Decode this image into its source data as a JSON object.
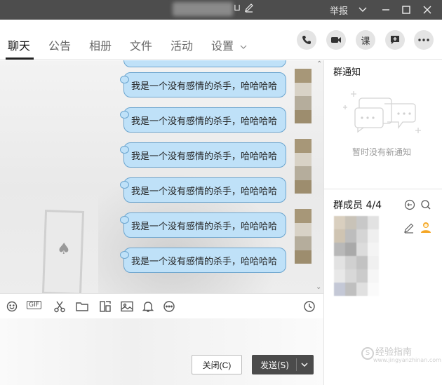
{
  "titlebar": {
    "report": "举报",
    "bg": "#4d4d4d"
  },
  "tabs": [
    {
      "label": "聊天",
      "active": true
    },
    {
      "label": "公告"
    },
    {
      "label": "相册"
    },
    {
      "label": "文件"
    },
    {
      "label": "活动"
    },
    {
      "label": "设置"
    }
  ],
  "right_buttons": {
    "course_label": "课"
  },
  "messages": [
    {
      "text": "我是一个没有感情的杀手，哈哈哈哈"
    },
    {
      "text": "我是一个没有感情的杀手，哈哈哈哈"
    },
    {
      "text": "我是一个没有感情的杀手，哈哈哈哈"
    },
    {
      "text": "我是一个没有感情的杀手，哈哈哈哈"
    },
    {
      "text": "我是一个没有感情的杀手，哈哈哈哈"
    },
    {
      "text": "我是一个没有感情的杀手，哈哈哈哈"
    }
  ],
  "toolbar": {
    "gif_label": "GIF"
  },
  "actions": {
    "close_label": "关闭(C)",
    "send_label": "发送(S)"
  },
  "notice": {
    "title": "群通知",
    "empty_text": "暂时没有新通知"
  },
  "members": {
    "title": "群成员 4/4"
  },
  "watermark": {
    "text": "经验指南",
    "url": "www.jingyanzhinan.com"
  },
  "colors": {
    "bubble": "#bfe1f8",
    "bubble_border": "#6ba5cf",
    "send_button": "#4b4b4b"
  }
}
